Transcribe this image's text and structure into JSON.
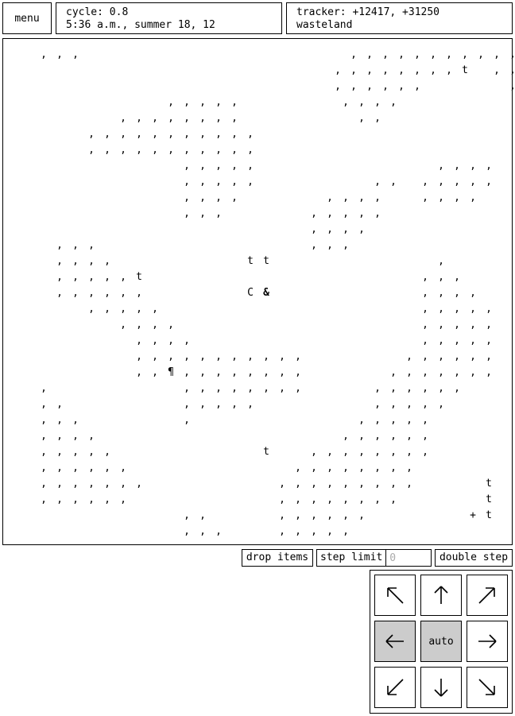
{
  "menu": {
    "label": "menu"
  },
  "status": {
    "cycle": "cycle: 0.8",
    "time": "5:36 a.m., summer 18, 12"
  },
  "tracker": {
    "coords": "tracker: +12417, +31250",
    "terrain": "wasteland"
  },
  "map": {
    "rows": [
      "    , , ,                                  , , , , , , , , , , ,   ",
      "                                         , , , , , , , , t   , ,   ",
      "                                         , , , , , ,           ,    ",
      "                    , , , , ,             , , , ,                  ",
      "              , , , , , , , ,               , ,                    ",
      "          , , , , , , , , , , ,                                    ",
      "          , , , , , , , , , , ,                                    ",
      "                      , , , , ,                       , , , ,      ",
      "                      , , , , ,               , ,   , , , , ,      ",
      "                      , , , ,           , , , ,     , , , ,        ",
      "                      , , ,           , , , , ,                    ",
      "                                      , , , ,                      ",
      "      , , ,                           , , ,                        ",
      "      , , , ,                 t t                     ,            ",
      "      , , , , , t                                   , , ,          ",
      "      , , , , , ,             C &                   , , , ,        ",
      "          , , , , ,                                 , , , , ,      ",
      "              , , , ,                               , , , , ,      ",
      "                , , , ,                             , , , , ,      ",
      "                , , , , , , , , , , ,             , , , , , ,      ",
      "                , , ¶ , , , , , , , ,           , , , , , , ,      ",
      "    ,                 , , , , , , , ,         , , , , , ,          ",
      "    , ,               , , , , ,               , , , , ,            ",
      "    , , ,             ,                     , , , , ,              ",
      "    , , , ,                               , , , , , ,              ",
      "    , , , , ,                   t     , , , , , , , ,              ",
      "    , , , , , ,                     , , , , , , , ,                ",
      "    , , , , , , ,                 , , , , , , , , ,         t      ",
      "    , , , , , ,                   , , , , , , , ,           t      ",
      "                      , ,         , , , , , ,             + t      ",
      "                      , , ,       , , , , ,                        "
    ],
    "bold_glyphs": [
      "&"
    ]
  },
  "controls": {
    "drop_items": "drop items",
    "step_limit_label": "step limit",
    "step_limit_placeholder": "0",
    "double_step": "double step"
  },
  "pad": {
    "auto_label": "auto",
    "active_color": "#cccccc",
    "buttons": [
      {
        "name": "move-northwest-button",
        "icon": "arrow-up-left-icon",
        "active": false
      },
      {
        "name": "move-north-button",
        "icon": "arrow-up-icon",
        "active": false
      },
      {
        "name": "move-northeast-button",
        "icon": "arrow-up-right-icon",
        "active": false
      },
      {
        "name": "move-west-button",
        "icon": "arrow-left-icon",
        "active": true
      },
      {
        "name": "auto-button",
        "icon": "",
        "active": true
      },
      {
        "name": "move-east-button",
        "icon": "arrow-right-icon",
        "active": false
      },
      {
        "name": "move-southwest-button",
        "icon": "arrow-down-left-icon",
        "active": false
      },
      {
        "name": "move-south-button",
        "icon": "arrow-down-icon",
        "active": false
      },
      {
        "name": "move-southeast-button",
        "icon": "arrow-down-right-icon",
        "active": false
      }
    ]
  }
}
